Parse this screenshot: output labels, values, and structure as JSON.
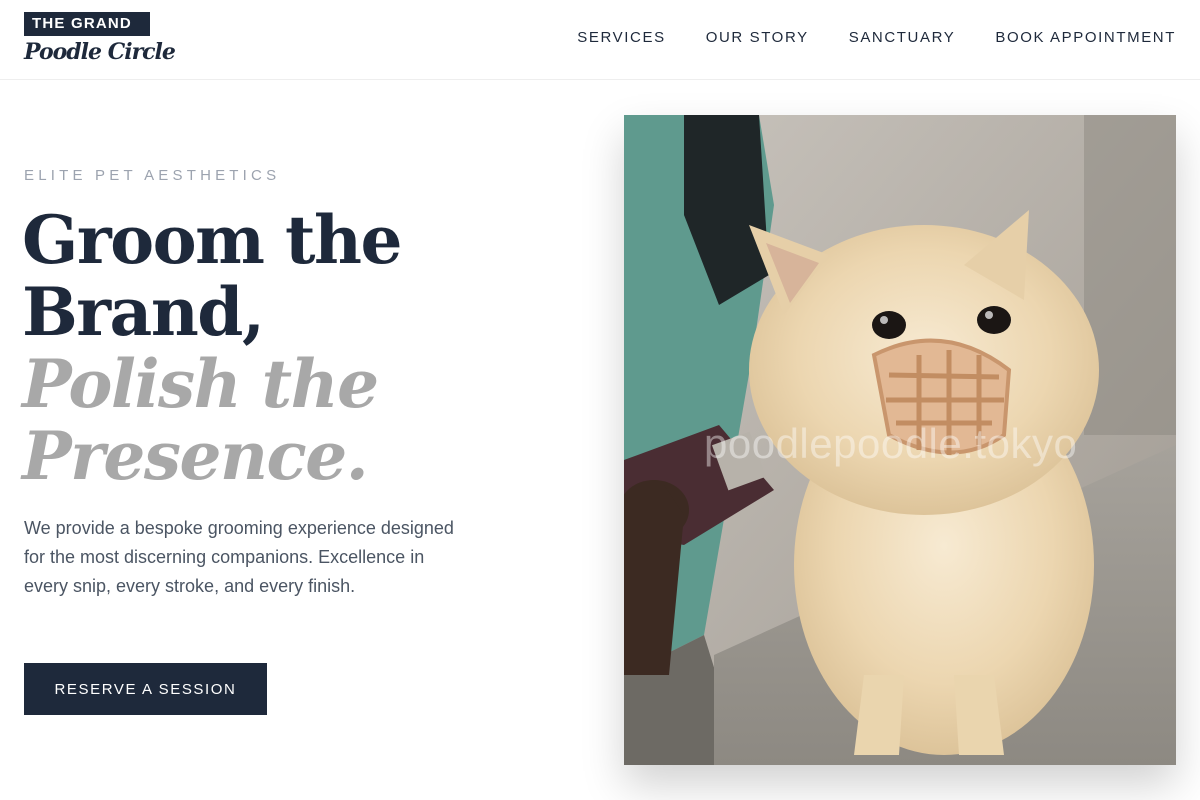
{
  "brand": {
    "line1": "THE GRAND",
    "line2": "Poodle Circle"
  },
  "nav": {
    "items": [
      "SERVICES",
      "OUR STORY",
      "SANCTUARY",
      "BOOK APPOINTMENT"
    ]
  },
  "hero": {
    "eyebrow": "ELITE PET AESTHETICS",
    "headline_line1": "Groom the",
    "headline_line2": "Brand,",
    "headline_line3": "Polish the",
    "headline_line4": "Presence.",
    "description": "We provide a bespoke grooming experience designed for the most discerning companions. Excellence in every snip, every stroke, and every finish.",
    "cta_label": "RESERVE A SESSION"
  },
  "photo": {
    "watermark": "poodlepoodle.tokyo"
  },
  "colors": {
    "navy": "#1e293b",
    "muted": "#a8a8a8"
  }
}
